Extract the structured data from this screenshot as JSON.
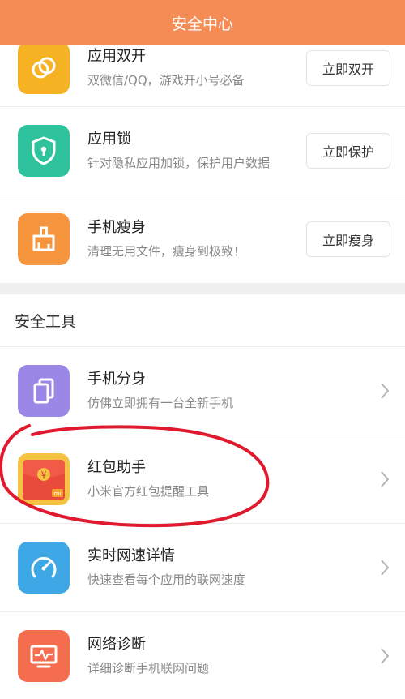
{
  "header": {
    "title": "安全中心"
  },
  "rows_top": [
    {
      "title": "应用双开",
      "subtitle": "双微信/QQ，游戏开小号必备",
      "action": "立即双开",
      "icon": "dual-app-icon",
      "color": "#f5b324"
    },
    {
      "title": "应用锁",
      "subtitle": "针对隐私应用加锁，保护用户数据",
      "action": "立即保护",
      "icon": "shield-lock-icon",
      "color": "#2ec39c"
    },
    {
      "title": "手机瘦身",
      "subtitle": "清理无用文件，瘦身到极致！",
      "action": "立即瘦身",
      "icon": "broom-icon",
      "color": "#f5953e"
    }
  ],
  "section": {
    "title": "安全工具"
  },
  "rows_tools": [
    {
      "title": "手机分身",
      "subtitle": "仿佛立即拥有一台全新手机",
      "icon": "second-space-icon",
      "color": "#9b87e6"
    },
    {
      "title": "红包助手",
      "subtitle": "小米官方红包提醒工具",
      "icon": "red-packet-icon",
      "color": "#f5c242"
    },
    {
      "title": "实时网速详情",
      "subtitle": "快速查看每个应用的联网速度",
      "icon": "speedometer-icon",
      "color": "#3ea8e6"
    },
    {
      "title": "网络诊断",
      "subtitle": "详细诊断手机联网问题",
      "icon": "network-monitor-icon",
      "color": "#f36d4e"
    }
  ],
  "red_packet_icon": {
    "badge": "mi",
    "symbol": "¥"
  }
}
